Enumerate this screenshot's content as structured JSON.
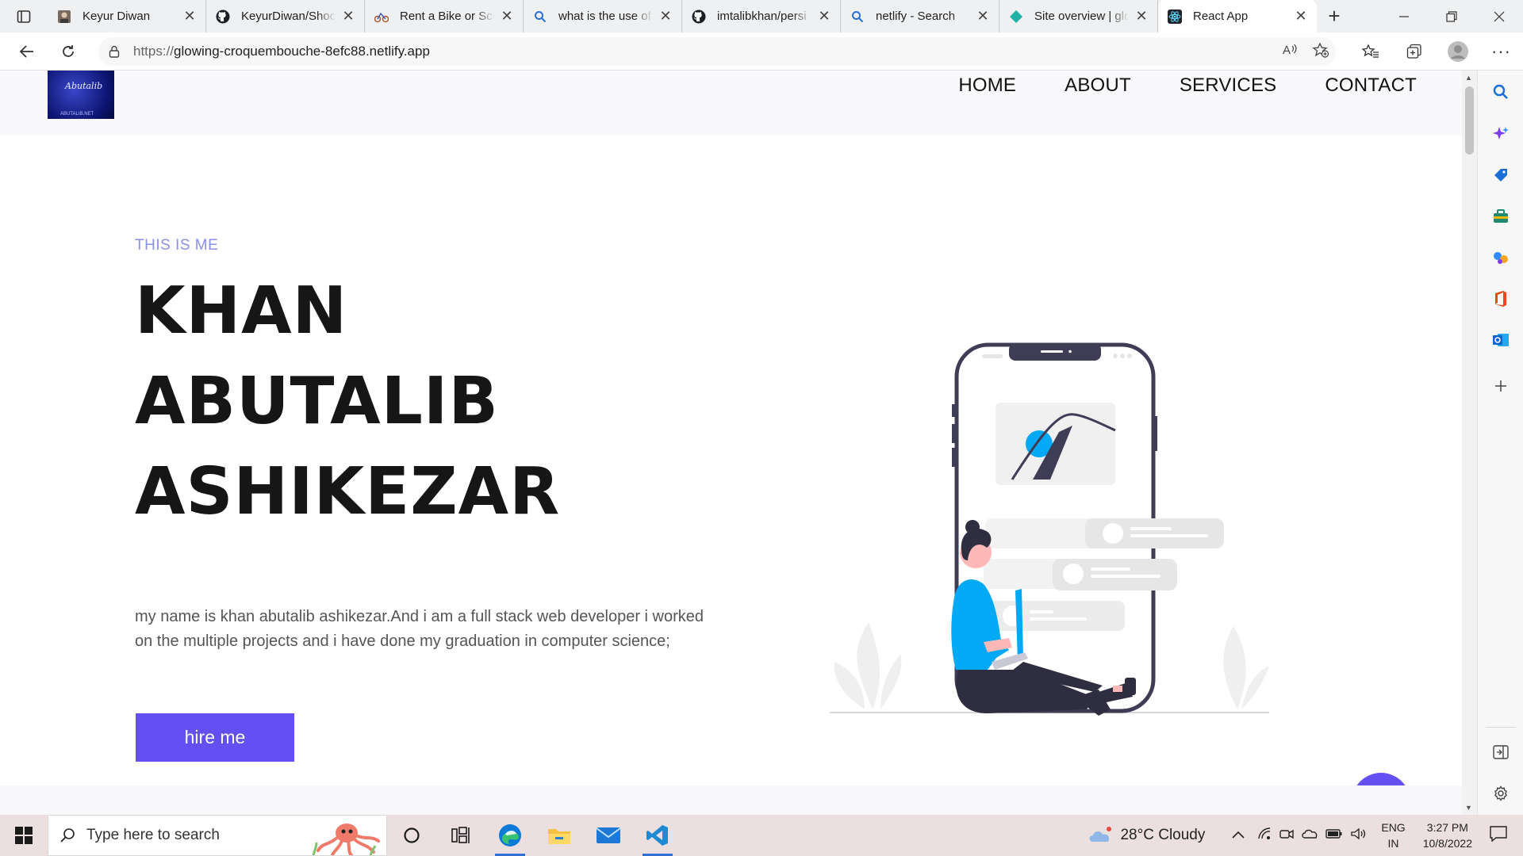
{
  "browser": {
    "tabs": [
      {
        "title": "Keyur Diwan",
        "icon": "profile-photo-icon"
      },
      {
        "title": "KeyurDiwan/Shoc",
        "icon": "github-icon"
      },
      {
        "title": "Rent a Bike or Scc",
        "icon": "bike-rental-icon"
      },
      {
        "title": "what is the use of",
        "icon": "bing-search-icon"
      },
      {
        "title": "imtalibkhan/persi",
        "icon": "github-icon"
      },
      {
        "title": "netlify - Search",
        "icon": "bing-search-icon"
      },
      {
        "title": "Site overview | glo",
        "icon": "netlify-icon"
      },
      {
        "title": "React App",
        "icon": "react-icon",
        "active": true
      }
    ],
    "url_prefix": "https://",
    "url_host": "glowing-croquembouche-8efc88.netlify.app"
  },
  "site": {
    "logo_text": "Abutalib",
    "logo_subtext": "ABUTALIB.NET",
    "nav": [
      "HOME",
      "ABOUT",
      "SERVICES",
      "CONTACT"
    ],
    "kicker": "THIS IS ME",
    "name_lines": [
      "KHAN",
      "ABUTALIB",
      "ASHIKEZAR"
    ],
    "bio": "my name is khan abutalib ashikezar.And i am a full stack web developer i worked on the multiple projects and i have done my graduation in computer science;",
    "cta": "hire me",
    "accent": "#6350f2"
  },
  "taskbar": {
    "search_placeholder": "Type here to search",
    "weather": "28°C  Cloudy",
    "lang": "ENG",
    "region": "IN",
    "time": "3:27 PM",
    "date": "10/8/2022"
  }
}
